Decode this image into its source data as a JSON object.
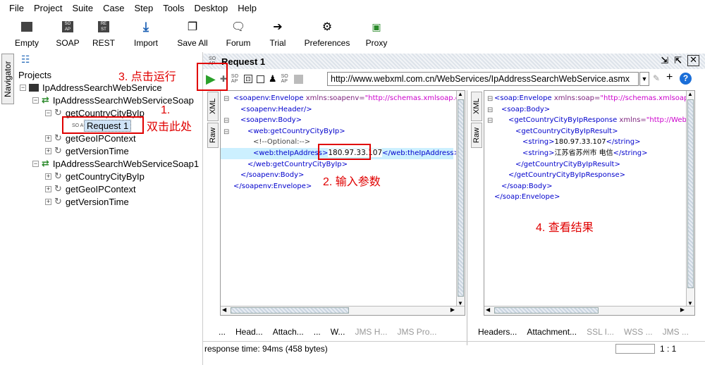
{
  "menu": [
    "File",
    "Project",
    "Suite",
    "Case",
    "Step",
    "Tools",
    "Desktop",
    "Help"
  ],
  "toolbar": [
    {
      "label": "Empty",
      "icon": "empty-project-icon"
    },
    {
      "label": "SOAP",
      "icon": "soap-icon"
    },
    {
      "label": "REST",
      "icon": "rest-icon"
    },
    {
      "label": "Import",
      "icon": "import-icon"
    },
    {
      "label": "Save All",
      "icon": "save-all-icon"
    },
    {
      "label": "Forum",
      "icon": "forum-icon"
    },
    {
      "label": "Trial",
      "icon": "trial-icon"
    },
    {
      "label": "Preferences",
      "icon": "preferences-icon"
    },
    {
      "label": "Proxy",
      "icon": "proxy-icon"
    }
  ],
  "navigator_tab": "Navigator",
  "tree": {
    "root": "Projects",
    "project": "IpAddressSearchWebService",
    "iface1": "IpAddressSearchWebServiceSoap",
    "op1": "getCountryCityByIp",
    "request": "Request 1",
    "op2": "getGeoIPContext",
    "op3": "getVersionTime",
    "iface2": "IpAddressSearchWebServiceSoap1",
    "op4": "getCountryCityByIp",
    "op5": "getGeoIPContext",
    "op6": "getVersionTime"
  },
  "editor": {
    "title": "Request 1",
    "url": "http://www.webxml.com.cn/WebServices/IpAddressSearchWebService.asmx",
    "side_tabs": {
      "xml": "XML",
      "raw": "Raw"
    },
    "request_lines": {
      "l1t": "<soapenv:Envelope",
      "l1a": " xmlns:soapenv=",
      "l1v": "\"http://schemas.xmlsoap.or",
      "l2": "<soapenv:Header/>",
      "l3": "<soapenv:Body>",
      "l4": "<web:getCountryCityByIp>",
      "l5": "<!--Optional:-->",
      "l6a": "<web:theIpAddress>",
      "l6v": "180.97.33.107",
      "l6b": "</web:theIpAddress>",
      "l7": "</web:getCountryCityByIp>",
      "l8": "</soapenv:Body>",
      "l9": "</soapenv:Envelope>"
    },
    "response_lines": {
      "l1t": "<soap:Envelope",
      "l1a": " xmlns:soap=",
      "l1v": "\"http://schemas.xmlsoap.or",
      "l2": "<soap:Body>",
      "l3t": "<getCountryCityByIpResponse",
      "l3a": " xmlns=",
      "l3v": "\"http://WebXml",
      "l4": "<getCountryCityByIpResult>",
      "l5a": "<string>",
      "l5v": "180.97.33.107",
      "l5b": "</string>",
      "l6a": "<string>",
      "l6v": "江苏省苏州市 电信",
      "l6b": "</string>",
      "l7": "</getCountryCityByIpResult>",
      "l8": "</getCountryCityByIpResponse>",
      "l9": "</soap:Body>",
      "l10": "</soap:Envelope>"
    },
    "req_subtabs": [
      "...",
      "Head...",
      "Attach...",
      "...",
      "W...",
      "JMS H...",
      "JMS Pro..."
    ],
    "resp_subtabs": [
      "Headers...",
      "Attachment...",
      "SSL I...",
      "WSS ...",
      "JMS ..."
    ],
    "status": "response time: 94ms (458 bytes)",
    "cursor": "1 : 1"
  },
  "annotations": {
    "run": "3. 点击运行",
    "step1": "1.",
    "dbl": "双击此处",
    "input": "2. 输入参数",
    "view": "4. 查看结果"
  },
  "colors": {
    "annotation": "#e00000",
    "run": "#2aa02a",
    "tag": "#0000cc",
    "attr_value": "#cc00cc"
  }
}
